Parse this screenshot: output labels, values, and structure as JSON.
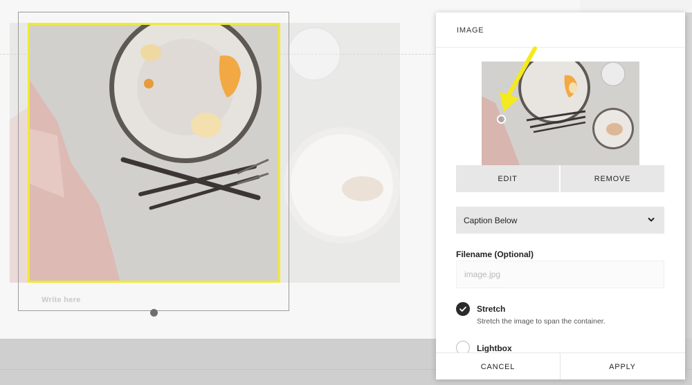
{
  "panel": {
    "title": "IMAGE",
    "edit_label": "EDIT",
    "remove_label": "REMOVE",
    "caption_select": {
      "value": "Caption Below"
    },
    "filename": {
      "label": "Filename (Optional)",
      "value": "",
      "placeholder": "image.jpg"
    },
    "options": [
      {
        "label": "Stretch",
        "description": "Stretch the image to span the container.",
        "checked": true
      },
      {
        "label": "Lightbox",
        "checked": false
      }
    ],
    "cancel_label": "CANCEL",
    "apply_label": "APPLY"
  },
  "canvas": {
    "caption_placeholder": "Write here"
  },
  "colors": {
    "selection_outline": "#f1ea2d",
    "annotation_arrow": "#f4ea1c",
    "button_bg": "#e7e7e7",
    "checkbox_on": "#2b2b2b"
  },
  "icons": {
    "caption_select": "chevron-down-icon",
    "stretch_check": "checkmark-icon",
    "focal_point": "focal-point-handle",
    "annotation": "yellow-arrow-annotation"
  }
}
